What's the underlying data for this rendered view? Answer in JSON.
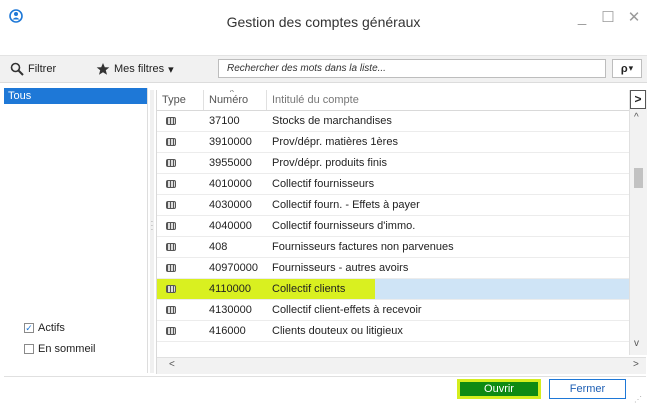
{
  "window": {
    "title": "Gestion des comptes généraux",
    "minimize_glyph": "_",
    "maximize_glyph": "☐",
    "close_glyph": "✕",
    "app_icon": "app-logo-icon"
  },
  "toolbar": {
    "filter_label": "Filtrer",
    "my_filters_label": "Mes filtres",
    "my_filters_caret": "▾",
    "search_placeholder": "Rechercher des mots dans la liste...",
    "search_button_glyph": "ρ",
    "search_button_caret": "▾"
  },
  "left_panel": {
    "filters": [
      "Tous"
    ],
    "selected_filter": "Tous",
    "checkboxes": [
      {
        "label": "Actifs",
        "checked": true
      },
      {
        "label": "En sommeil",
        "checked": false
      }
    ],
    "checkmark": "✓"
  },
  "grid": {
    "columns": [
      "Type",
      "Numéro",
      "Intitulé du compte"
    ],
    "sort_glyph": "^",
    "rows": [
      {
        "numero": "37100",
        "intitule": "Stocks de marchandises"
      },
      {
        "numero": "3910000",
        "intitule": "Prov/dépr.  matières 1ères"
      },
      {
        "numero": "3955000",
        "intitule": "Prov/dépr. produits finis"
      },
      {
        "numero": "4010000",
        "intitule": "Collectif fournisseurs"
      },
      {
        "numero": "4030000",
        "intitule": "Collectif fourn. - Effets à payer"
      },
      {
        "numero": "4040000",
        "intitule": "Collectif fournisseurs d'immo."
      },
      {
        "numero": "408",
        "intitule": "Fournisseurs factures non parvenues"
      },
      {
        "numero": "40970000",
        "intitule": "Fournisseurs - autres avoirs"
      },
      {
        "numero": "4110000",
        "intitule": "Collectif clients"
      },
      {
        "numero": "4130000",
        "intitule": "Collectif client-effets à recevoir"
      },
      {
        "numero": "416000",
        "intitule": "Clients douteux ou litigieux"
      }
    ],
    "selected_row_index": 8,
    "column_chooser_glyph": ">",
    "scroll_up_glyph": "^",
    "scroll_down_glyph": "v",
    "scroll_left_glyph": "<",
    "scroll_right_glyph": ">"
  },
  "footer": {
    "open_label": "Ouvrir",
    "close_label": "Fermer"
  },
  "colors": {
    "selection_blue": "#1e78d7",
    "row_selected": "#cfe4f6",
    "highlight_yellow": "#d9f020",
    "open_green": "#0e8a13"
  }
}
